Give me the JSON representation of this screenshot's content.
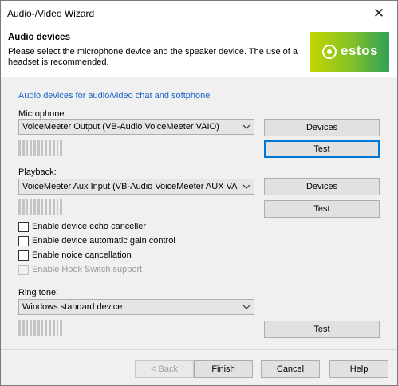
{
  "window": {
    "title": "Audio-/Video Wizard",
    "close_glyph": "✕"
  },
  "header": {
    "title": "Audio devices",
    "description": "Please select the microphone device and the speaker device. The use of a headset is recommended.",
    "logo_text": "estos"
  },
  "group": {
    "title": "Audio devices for audio/video chat and softphone"
  },
  "microphone": {
    "label": "Microphone:",
    "selected": "VoiceMeeter Output (VB-Audio VoiceMeeter VAIO)",
    "devices_label": "Devices",
    "test_label": "Test"
  },
  "playback": {
    "label": "Playback:",
    "selected": "VoiceMeeter Aux Input (VB-Audio VoiceMeeter AUX VAIO)",
    "devices_label": "Devices",
    "test_label": "Test"
  },
  "options": [
    {
      "label": "Enable device echo canceller",
      "checked": false,
      "enabled": true
    },
    {
      "label": "Enable device automatic gain control",
      "checked": false,
      "enabled": true
    },
    {
      "label": "Enable noice cancellation",
      "checked": false,
      "enabled": true
    },
    {
      "label": "Enable Hook Switch support",
      "checked": false,
      "enabled": false
    }
  ],
  "ringtone": {
    "label": "Ring tone:",
    "selected": "Windows standard device",
    "test_label": "Test"
  },
  "footer": {
    "back_label": "< Back",
    "finish_label": "Finish",
    "cancel_label": "Cancel",
    "help_label": "Help"
  },
  "colors": {
    "accent": "#0078d7",
    "group_title": "#1a63c6",
    "logo_start": "#c4d600",
    "logo_end": "#2fa05a"
  }
}
